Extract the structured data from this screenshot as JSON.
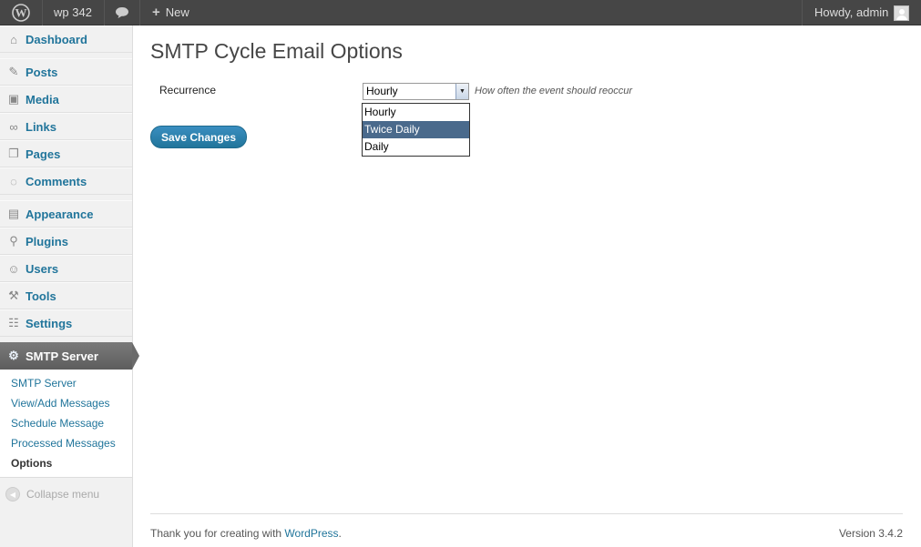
{
  "admin_bar": {
    "site_name": "wp 342",
    "new_label": "New",
    "greeting": "Howdy, admin"
  },
  "sidebar": {
    "items": [
      {
        "label": "Dashboard",
        "icon": "home-icon"
      },
      {
        "label": "Posts",
        "icon": "pushpin-icon"
      },
      {
        "label": "Media",
        "icon": "media-icon"
      },
      {
        "label": "Links",
        "icon": "link-icon"
      },
      {
        "label": "Pages",
        "icon": "page-icon"
      },
      {
        "label": "Comments",
        "icon": "comment-icon"
      },
      {
        "label": "Appearance",
        "icon": "appearance-icon"
      },
      {
        "label": "Plugins",
        "icon": "plugin-icon"
      },
      {
        "label": "Users",
        "icon": "users-icon"
      },
      {
        "label": "Tools",
        "icon": "tools-icon"
      },
      {
        "label": "Settings",
        "icon": "settings-icon"
      }
    ],
    "current": {
      "label": "SMTP Server",
      "icon": "gear-icon"
    },
    "submenu": [
      "SMTP Server",
      "View/Add Messages",
      "Schedule Message",
      "Processed Messages",
      "Options"
    ],
    "submenu_current": "Options",
    "collapse_label": "Collapse menu"
  },
  "main": {
    "title": "SMTP Cycle Email Options",
    "recurrence_label": "Recurrence",
    "recurrence_value": "Hourly",
    "recurrence_options": [
      "Hourly",
      "Twice Daily",
      "Daily"
    ],
    "highlighted_option": "Twice Daily",
    "recurrence_description": "How often the event should reoccur",
    "save_label": "Save Changes"
  },
  "footer": {
    "thanks_prefix": "Thank you for creating with ",
    "thanks_link": "WordPress",
    "thanks_suffix": ".",
    "version": "Version 3.4.2"
  },
  "colors": {
    "admin_bar_bg": "#464646",
    "link_blue": "#21759b",
    "highlight": "#4a6a8c"
  }
}
